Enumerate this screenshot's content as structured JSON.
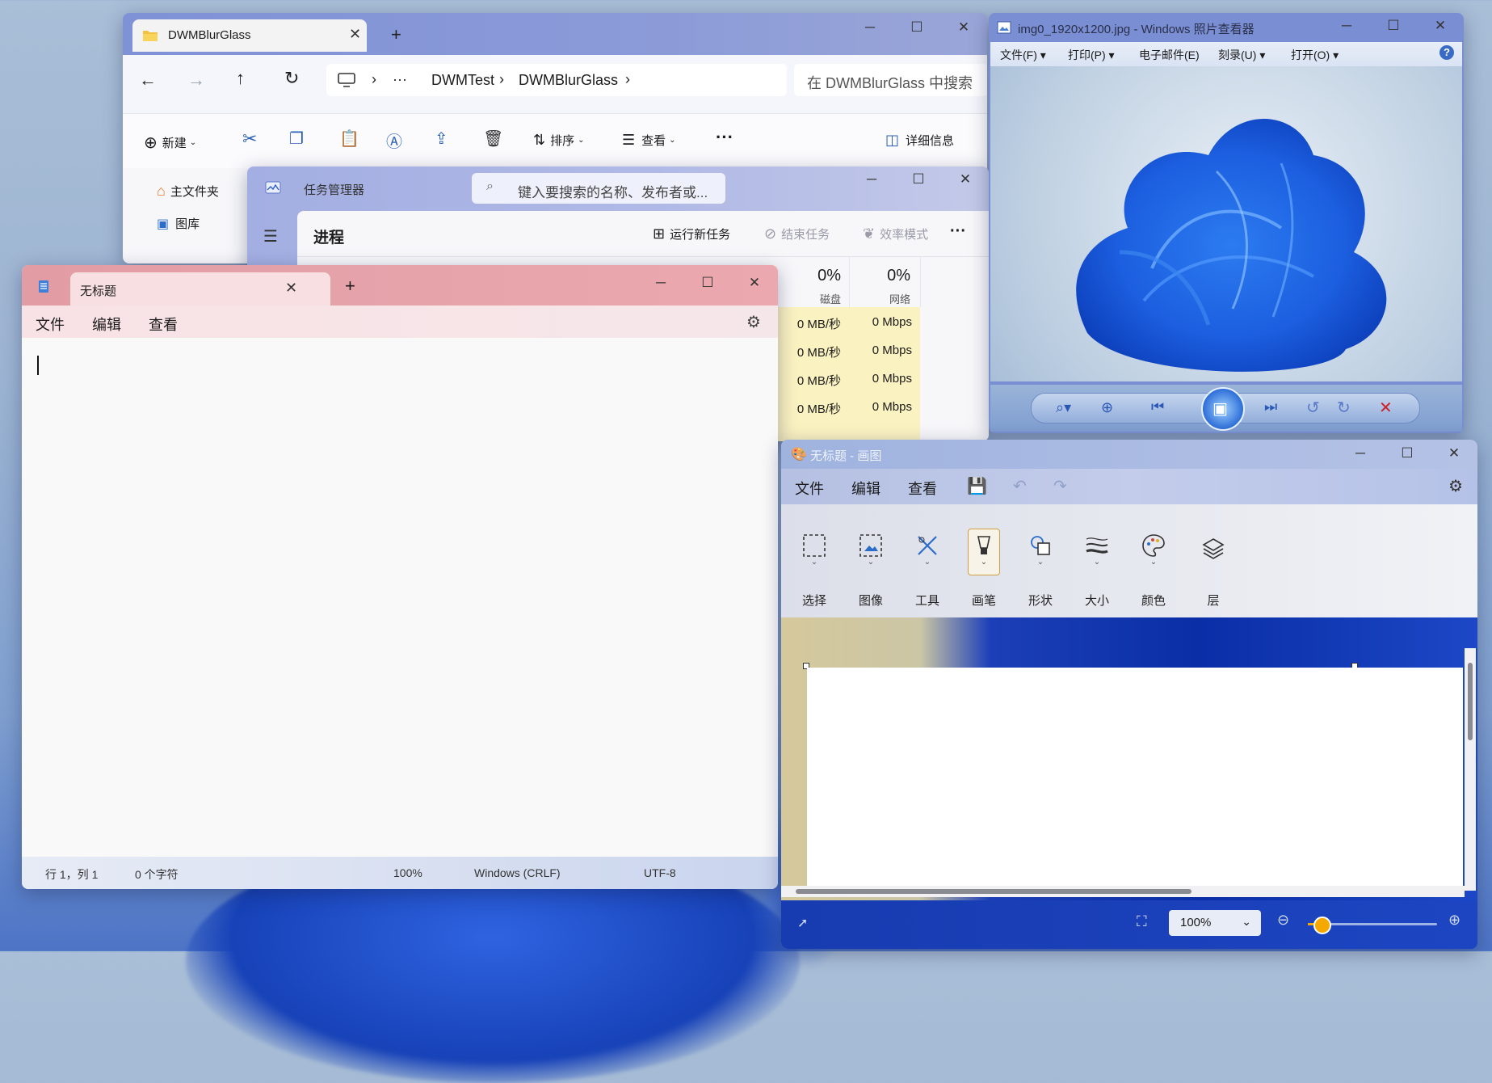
{
  "explorer": {
    "tab_title": "DWMBlurGlass",
    "new_tab": "+",
    "address": {
      "ellipsis": "···",
      "crumb1": "DWMTest",
      "crumb2": "DWMBlurGlass",
      "sep": "›"
    },
    "search_placeholder": "在 DWMBlurGlass 中搜索",
    "cmd": {
      "new": "新建",
      "sort": "排序",
      "view": "查看",
      "more": "···",
      "details": "详细信息"
    },
    "sidebar": [
      {
        "label": "主文件夹",
        "icon": "home-icon"
      },
      {
        "label": "图库",
        "icon": "gallery-icon"
      }
    ]
  },
  "taskmgr": {
    "title": "任务管理器",
    "search_placeholder": "键入要搜索的名称、发布者或...",
    "page_title": "进程",
    "run_task": "运行新任务",
    "end_task": "结束任务",
    "efficiency": "效率模式",
    "more": "···",
    "columns": [
      {
        "pct": "0%",
        "name": "磁盘"
      },
      {
        "pct": "0%",
        "name": "网络"
      }
    ],
    "rows": [
      {
        "disk": "0 MB/秒",
        "net": "0 Mbps"
      },
      {
        "disk": "0 MB/秒",
        "net": "0 Mbps"
      },
      {
        "disk": "0 MB/秒",
        "net": "0 Mbps"
      },
      {
        "disk": "0 MB/秒",
        "net": "0 Mbps"
      }
    ]
  },
  "notepad": {
    "tab_title": "无标题",
    "new_tab": "+",
    "menu": [
      "文件",
      "编辑",
      "查看"
    ],
    "status": {
      "position": "行 1，列 1",
      "chars": "0 个字符",
      "zoom": "100%",
      "eol": "Windows (CRLF)",
      "encoding": "UTF-8"
    }
  },
  "photo_viewer": {
    "title": "img0_1920x1200.jpg - Windows 照片查看器",
    "menu": [
      "文件(F)",
      "打印(P)",
      "电子邮件(E)",
      "刻录(U)",
      "打开(O)"
    ],
    "menu_dropdown": [
      true,
      true,
      false,
      true,
      true
    ],
    "help": "?"
  },
  "paint": {
    "title": "无标题 - 画图",
    "menu": [
      "文件",
      "编辑",
      "查看"
    ],
    "tools": [
      {
        "label": "选择",
        "icon": "select-icon"
      },
      {
        "label": "图像",
        "icon": "image-icon"
      },
      {
        "label": "工具",
        "icon": "tools-icon"
      },
      {
        "label": "画笔",
        "icon": "brush-icon"
      },
      {
        "label": "形状",
        "icon": "shapes-icon"
      },
      {
        "label": "大小",
        "icon": "size-icon"
      },
      {
        "label": "颜色",
        "icon": "palette-icon"
      },
      {
        "label": "层",
        "icon": "layers-icon"
      }
    ],
    "zoom": "100%",
    "zoom_slider_fraction": 0.1
  }
}
